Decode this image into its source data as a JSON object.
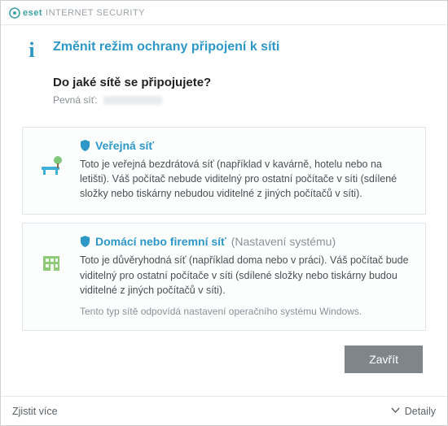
{
  "brand": {
    "name": "eset",
    "product": "INTERNET SECURITY"
  },
  "header": {
    "title": "Změnit režim ochrany připojení k síti"
  },
  "question": "Do jaké sítě se připojujete?",
  "meta_label": "Pevná síť:",
  "options": [
    {
      "title": "Veřejná síť",
      "suffix": "",
      "desc": "Toto je veřejná bezdrátová síť (například v kavárně, hotelu nebo na letišti). Váš počítač nebude viditelný pro ostatní počítače v síti (sdílené složky nebo tiskárny nebudou viditelné z jiných počítačů v síti).",
      "note": ""
    },
    {
      "title": "Domácí nebo firemní síť",
      "suffix": "(Nastavení systému)",
      "desc": "Toto je důvěryhodná síť (například doma nebo v práci). Váš počítač bude viditelný pro ostatní počítače v síti (sdílené složky nebo tiskárny budou viditelné z jiných počítačů v síti).",
      "note": "Tento typ sítě odpovídá nastavení operačního systému Windows."
    }
  ],
  "buttons": {
    "close": "Zavřít"
  },
  "footer": {
    "learn_more": "Zjistit více",
    "details": "Detaily"
  }
}
